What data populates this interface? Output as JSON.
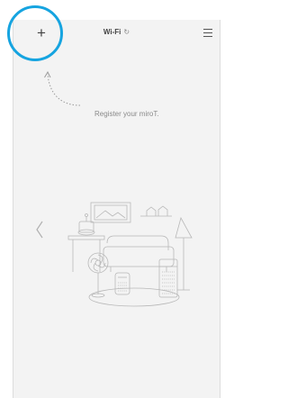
{
  "header": {
    "add_symbol": "+",
    "title": "Wi-Fi",
    "refresh_symbol": "↻"
  },
  "main": {
    "register_text": "Register your miroT."
  },
  "icons": {
    "add": "plus-icon",
    "menu": "hamburger-menu-icon",
    "refresh": "refresh-icon",
    "prev": "chevron-left-icon"
  },
  "colors": {
    "highlight": "#16a4e0",
    "screen_bg": "#f3f3f3",
    "line": "#b5b5b5"
  }
}
